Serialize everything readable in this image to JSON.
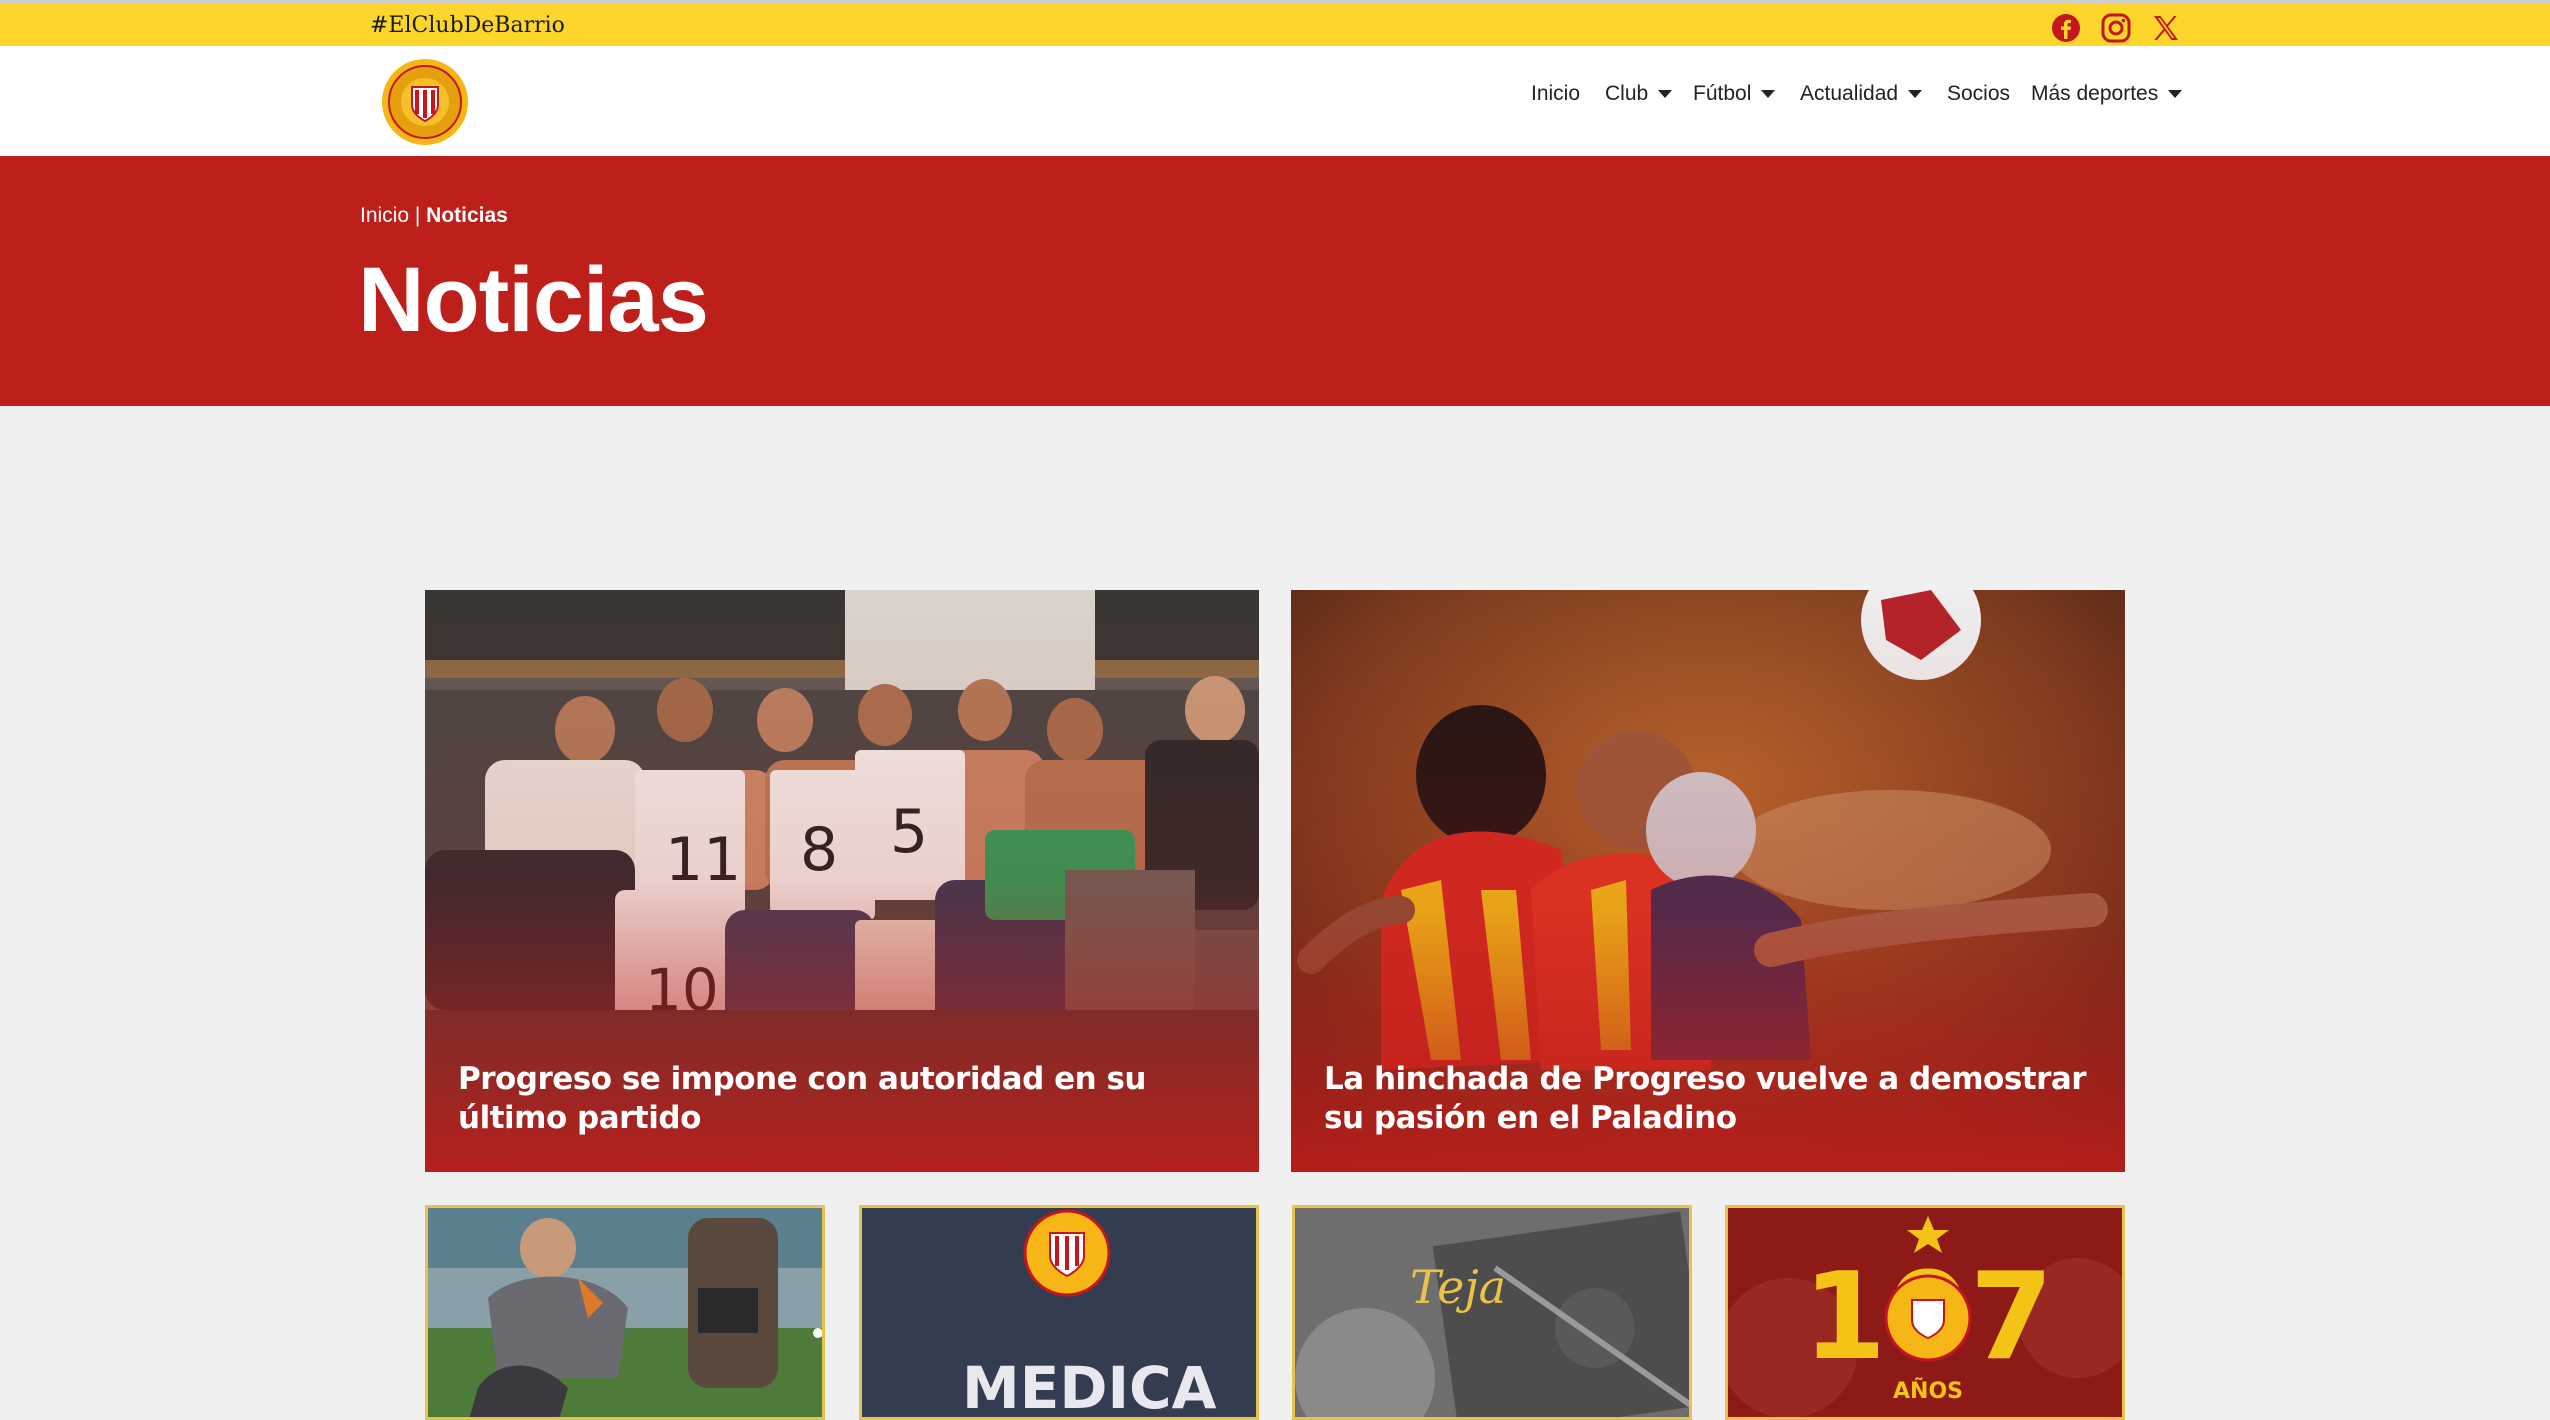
{
  "topbar": {
    "hashtag": "#ElClubDeBarrio",
    "social_icons": [
      "facebook-icon",
      "instagram-icon",
      "x-icon"
    ],
    "accent_color": "#fcd62a",
    "icon_color": "#c4161c"
  },
  "nav": {
    "items": [
      {
        "label": "Inicio",
        "dropdown": false
      },
      {
        "label": "Club",
        "dropdown": true
      },
      {
        "label": "Fútbol",
        "dropdown": true
      },
      {
        "label": "Actualidad",
        "dropdown": true
      },
      {
        "label": "Socios",
        "dropdown": false
      },
      {
        "label": "Más deportes",
        "dropdown": true
      }
    ]
  },
  "hero": {
    "breadcrumb_home": "Inicio",
    "breadcrumb_separator": " | ",
    "breadcrumb_current": "Noticias",
    "title": "Noticias",
    "background": "#bd1f1b"
  },
  "news": {
    "featured": [
      {
        "title": "Progreso se impone con autoridad en su último partido"
      },
      {
        "title": "La hinchada de Progreso vuelve a demostrar su pasión en el Paladino"
      }
    ],
    "small_cards": [
      {
        "text": ""
      },
      {
        "text": "MEDICA"
      },
      {
        "text": "Teja"
      },
      {
        "text": "107",
        "caption": "AÑOS"
      }
    ]
  }
}
